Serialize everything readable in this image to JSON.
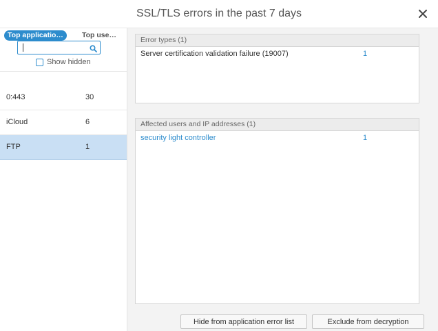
{
  "dialog": {
    "title": "SSL/TLS errors in the past 7 days"
  },
  "left_panel": {
    "tabs": [
      {
        "label": "Top applicatio…",
        "active": true
      },
      {
        "label": "Top use…",
        "active": false
      }
    ],
    "search": {
      "value": "",
      "placeholder": ""
    },
    "show_hidden_label": "Show hidden",
    "show_hidden_checked": false,
    "rows": [
      {
        "name": "0:443",
        "count": "30",
        "selected": false
      },
      {
        "name": "iCloud",
        "count": "6",
        "selected": false
      },
      {
        "name": "FTP",
        "count": "1",
        "selected": true
      }
    ]
  },
  "error_types": {
    "header": "Error types (1)",
    "rows": [
      {
        "label": "Server certification validation failure (19007)",
        "value": "1"
      }
    ]
  },
  "affected": {
    "header": "Affected users and IP addresses (1)",
    "rows": [
      {
        "label": "security light controller",
        "value": "1"
      }
    ]
  },
  "buttons": {
    "hide": "Hide from application error list",
    "exclude": "Exclude from decryption"
  },
  "colors": {
    "accent": "#2d8ccd",
    "selected_row": "#c9dff4",
    "right_bg": "#f3f3f3",
    "panel_header": "#ececec"
  },
  "icons": {
    "close": "close-icon",
    "search": "search-icon",
    "checkbox": "checkbox-icon"
  }
}
